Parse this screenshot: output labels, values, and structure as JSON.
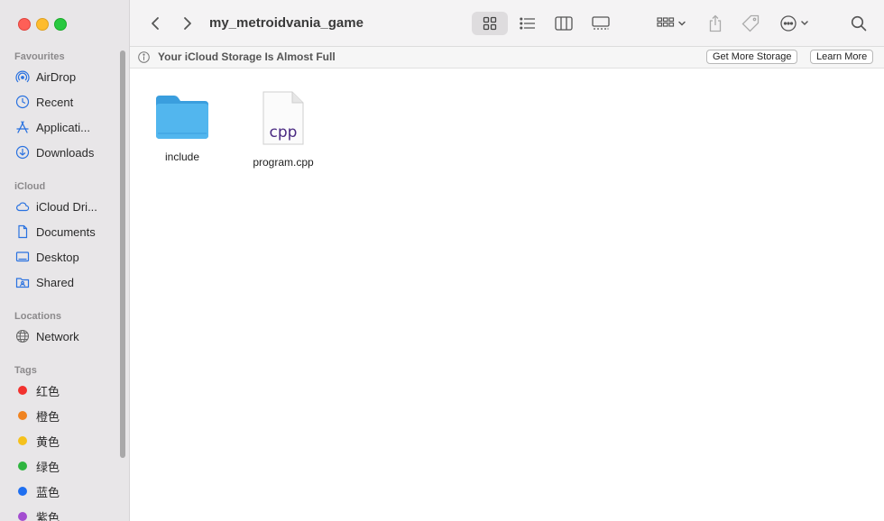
{
  "window": {
    "title": "my_metroidvania_game"
  },
  "sidebar": {
    "sections": {
      "favourites": "Favourites",
      "icloud": "iCloud",
      "locations": "Locations",
      "tags": "Tags"
    },
    "favourites": [
      {
        "label": "AirDrop",
        "icon": "airdrop-icon"
      },
      {
        "label": "Recent",
        "icon": "clock-icon"
      },
      {
        "label": "Applicati...",
        "icon": "applications-icon"
      },
      {
        "label": "Downloads",
        "icon": "download-icon"
      }
    ],
    "icloud": [
      {
        "label": "iCloud Dri...",
        "icon": "cloud-icon"
      },
      {
        "label": "Documents",
        "icon": "document-icon"
      },
      {
        "label": "Desktop",
        "icon": "desktop-icon"
      },
      {
        "label": "Shared",
        "icon": "shared-folder-icon"
      }
    ],
    "locations": [
      {
        "label": "Network",
        "icon": "globe-icon"
      }
    ],
    "tags": [
      {
        "label": "红色",
        "color": "#f2322f"
      },
      {
        "label": "橙色",
        "color": "#f08320"
      },
      {
        "label": "黄色",
        "color": "#f5c11c"
      },
      {
        "label": "绿色",
        "color": "#2fb540"
      },
      {
        "label": "蓝色",
        "color": "#1f6ff0"
      },
      {
        "label": "紫色",
        "color": "#a34dd0"
      }
    ]
  },
  "banner": {
    "text": "Your iCloud Storage Is Almost Full",
    "get_more": "Get More Storage",
    "learn_more": "Learn More"
  },
  "files": [
    {
      "name": "include",
      "type": "folder"
    },
    {
      "name": "program.cpp",
      "type": "cpp",
      "ext_label": "cpp"
    }
  ],
  "colors": {
    "folder": "#4fb4ec",
    "cpp_text": "#4a2a82",
    "accent": "#2a72e0"
  }
}
